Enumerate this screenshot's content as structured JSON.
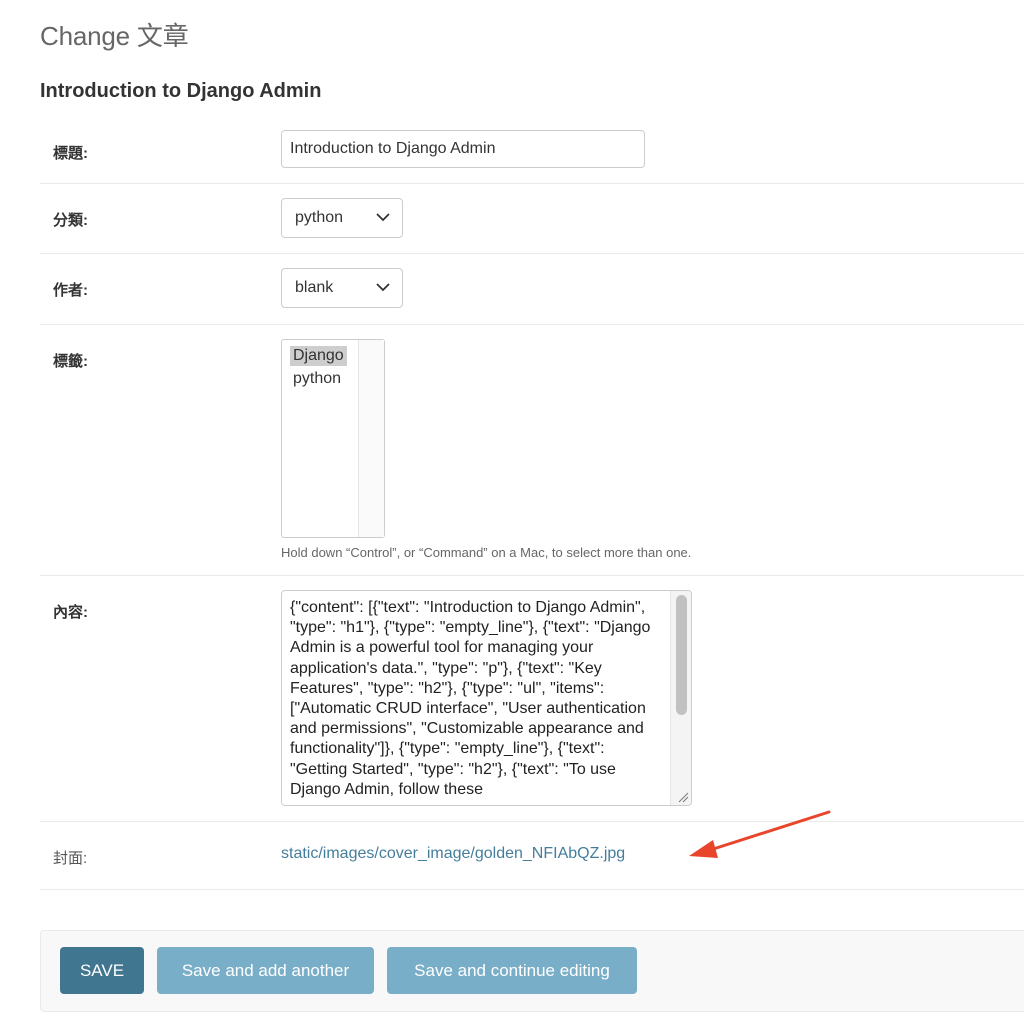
{
  "header": {
    "page_title": "Change 文章",
    "object_title": "Introduction to Django Admin"
  },
  "form": {
    "title_field": {
      "label": "標題:",
      "value": "Introduction to Django Admin"
    },
    "category_field": {
      "label": "分類:",
      "value": "python"
    },
    "author_field": {
      "label": "作者:",
      "value": "blank"
    },
    "tags_field": {
      "label": "標籤:",
      "options": [
        {
          "label": "Django",
          "selected": true
        },
        {
          "label": "python",
          "selected": false
        }
      ],
      "help_text": "Hold down “Control”, or “Command” on a Mac, to select more than one."
    },
    "content_field": {
      "label": "內容:",
      "value": "{\"content\": [{\"text\": \"Introduction to Django Admin\", \"type\": \"h1\"}, {\"type\": \"empty_line\"}, {\"text\": \"Django Admin is a powerful tool for managing your application's data.\", \"type\": \"p\"}, {\"text\": \"Key Features\", \"type\": \"h2\"}, {\"type\": \"ul\", \"items\": [\"Automatic CRUD interface\", \"User authentication and permissions\", \"Customizable appearance and functionality\"]}, {\"type\": \"empty_line\"}, {\"text\": \"Getting Started\", \"type\": \"h2\"}, {\"text\": \"To use Django Admin, follow these"
    },
    "cover_field": {
      "label": "封面:",
      "value": "static/images/cover_image/golden_NFIAbQZ.jpg"
    }
  },
  "actions": {
    "save_label": "SAVE",
    "save_add_label": "Save and add another",
    "save_continue_label": "Save and continue editing"
  },
  "colors": {
    "primary_button": "#417690",
    "secondary_button": "#79aec8",
    "link": "#447e9b",
    "annotation_arrow": "#e8452c"
  },
  "icons": {
    "select_chevron": "chevron-down-icon",
    "resize_grip": "resize-grip-icon",
    "annotation": "red-arrow-icon"
  }
}
